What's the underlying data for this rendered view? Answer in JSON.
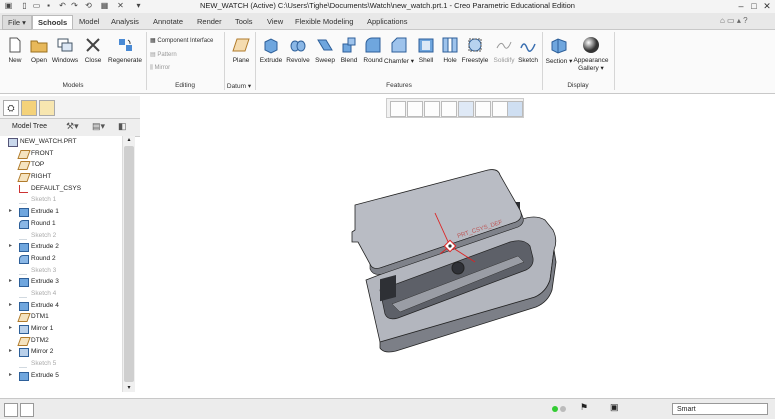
{
  "window": {
    "title": "NEW_WATCH (Active) C:\\Users\\Tighe\\Documents\\Watch\\new_watch.prt.1 - Creo Parametric Educational Edition",
    "quick_access": [
      "new-icon",
      "open-icon",
      "save-icon",
      "undo-icon",
      "redo-icon",
      "regenerate-icon",
      "windows-icon",
      "close-icon",
      "customize-icon"
    ],
    "controls": [
      "minimize",
      "maximize",
      "close"
    ]
  },
  "tabs": [
    "File",
    "Schools",
    "Model",
    "Analysis",
    "Annotate",
    "Render",
    "Tools",
    "View",
    "Flexible Modeling",
    "Applications"
  ],
  "active_tab": "Schools",
  "ribbon": {
    "models": {
      "label": "Models",
      "buttons": [
        "New",
        "Open",
        "Windows",
        "Close",
        "Regenerate"
      ]
    },
    "editing": {
      "label": "Editing",
      "items": [
        "Component Interface",
        "Pattern",
        "Mirror"
      ]
    },
    "datum": {
      "label": "Datum",
      "buttons": [
        "Plane"
      ]
    },
    "features": {
      "label": "Features",
      "buttons": [
        "Extrude",
        "Revolve",
        "Sweep",
        "Blend",
        "Round",
        "Chamfer",
        "Shell",
        "Hole",
        "Freestyle",
        "Solidify",
        "Sketch"
      ]
    },
    "display": {
      "label": "Display",
      "buttons": [
        "Section",
        "Appearance Gallery"
      ]
    }
  },
  "model_tree": {
    "header": "Model Tree",
    "items": [
      {
        "label": "NEW_WATCH.PRT",
        "icon": "part-icon",
        "expandable": false,
        "dim": false
      },
      {
        "label": "FRONT",
        "icon": "datum-plane-icon",
        "expandable": false,
        "dim": false
      },
      {
        "label": "TOP",
        "icon": "datum-plane-icon",
        "expandable": false,
        "dim": false
      },
      {
        "label": "RIGHT",
        "icon": "datum-plane-icon",
        "expandable": false,
        "dim": false
      },
      {
        "label": "DEFAULT_CSYS",
        "icon": "csys-icon",
        "expandable": false,
        "dim": false
      },
      {
        "label": "Sketch 1",
        "icon": "sketch-icon",
        "expandable": false,
        "dim": true
      },
      {
        "label": "Extrude 1",
        "icon": "extrude-icon",
        "expandable": true,
        "dim": false
      },
      {
        "label": "Round 1",
        "icon": "round-icon",
        "expandable": false,
        "dim": false
      },
      {
        "label": "Sketch 2",
        "icon": "sketch-icon",
        "expandable": false,
        "dim": true
      },
      {
        "label": "Extrude 2",
        "icon": "extrude-icon",
        "expandable": true,
        "dim": false
      },
      {
        "label": "Round 2",
        "icon": "round-icon",
        "expandable": false,
        "dim": false
      },
      {
        "label": "Sketch 3",
        "icon": "sketch-icon",
        "expandable": false,
        "dim": true
      },
      {
        "label": "Extrude 3",
        "icon": "extrude-icon",
        "expandable": true,
        "dim": false
      },
      {
        "label": "Sketch 4",
        "icon": "sketch-icon",
        "expandable": false,
        "dim": true
      },
      {
        "label": "Extrude 4",
        "icon": "extrude-icon",
        "expandable": true,
        "dim": false
      },
      {
        "label": "DTM1",
        "icon": "datum-plane-icon",
        "expandable": false,
        "dim": false
      },
      {
        "label": "Mirror 1",
        "icon": "mirror-icon",
        "expandable": true,
        "dim": false
      },
      {
        "label": "DTM2",
        "icon": "datum-plane-icon",
        "expandable": false,
        "dim": false
      },
      {
        "label": "Mirror 2",
        "icon": "mirror-icon",
        "expandable": true,
        "dim": false
      },
      {
        "label": "Sketch 5",
        "icon": "sketch-icon",
        "expandable": false,
        "dim": true
      },
      {
        "label": "Extrude 5",
        "icon": "extrude-icon",
        "expandable": true,
        "dim": false
      }
    ]
  },
  "viewport": {
    "csys_label": "PRT_CSYS_DEF"
  },
  "status": {
    "filter": "Smart"
  }
}
